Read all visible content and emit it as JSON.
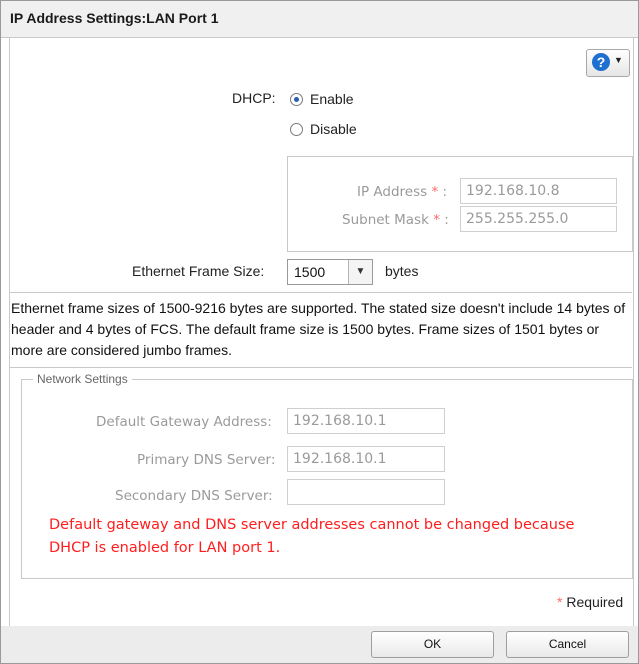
{
  "dialog": {
    "title": "IP Address Settings:LAN Port 1"
  },
  "help": {
    "icon": "question-icon",
    "label": "?"
  },
  "dhcp": {
    "label": "DHCP:",
    "options": [
      {
        "label": "Enable",
        "selected": true
      },
      {
        "label": "Disable",
        "selected": false
      }
    ]
  },
  "static_ip": {
    "ip_label": "IP Address",
    "ip_value": "192.168.10.8",
    "mask_label": "Subnet Mask",
    "mask_value": "255.255.255.0",
    "required_mark": "*",
    "colon": ":"
  },
  "frame": {
    "label": "Ethernet Frame Size:",
    "value": "1500",
    "unit": "bytes",
    "info": "Ethernet frame sizes of 1500-9216 bytes are supported. The stated size doesn't include 14 bytes of header and 4 bytes of FCS. The default frame size is 1500 bytes. Frame sizes of 1501 bytes or more are considered jumbo frames."
  },
  "network": {
    "legend": "Network Settings",
    "gateway_label": "Default Gateway Address:",
    "gateway_value": "192.168.10.1",
    "primary_dns_label": "Primary DNS Server:",
    "primary_dns_value": "192.168.10.1",
    "secondary_dns_label": "Secondary DNS Server:",
    "secondary_dns_value": "",
    "warning": "Default gateway and DNS server addresses cannot be changed because DHCP is enabled for LAN port 1."
  },
  "required_note": {
    "mark": "*",
    "text": "Required"
  },
  "buttons": {
    "ok": "OK",
    "cancel": "Cancel"
  },
  "colors": {
    "warning": "#ff1e1e",
    "required_mark": "#ff6a6a",
    "help_icon": "#1f6fd0"
  }
}
